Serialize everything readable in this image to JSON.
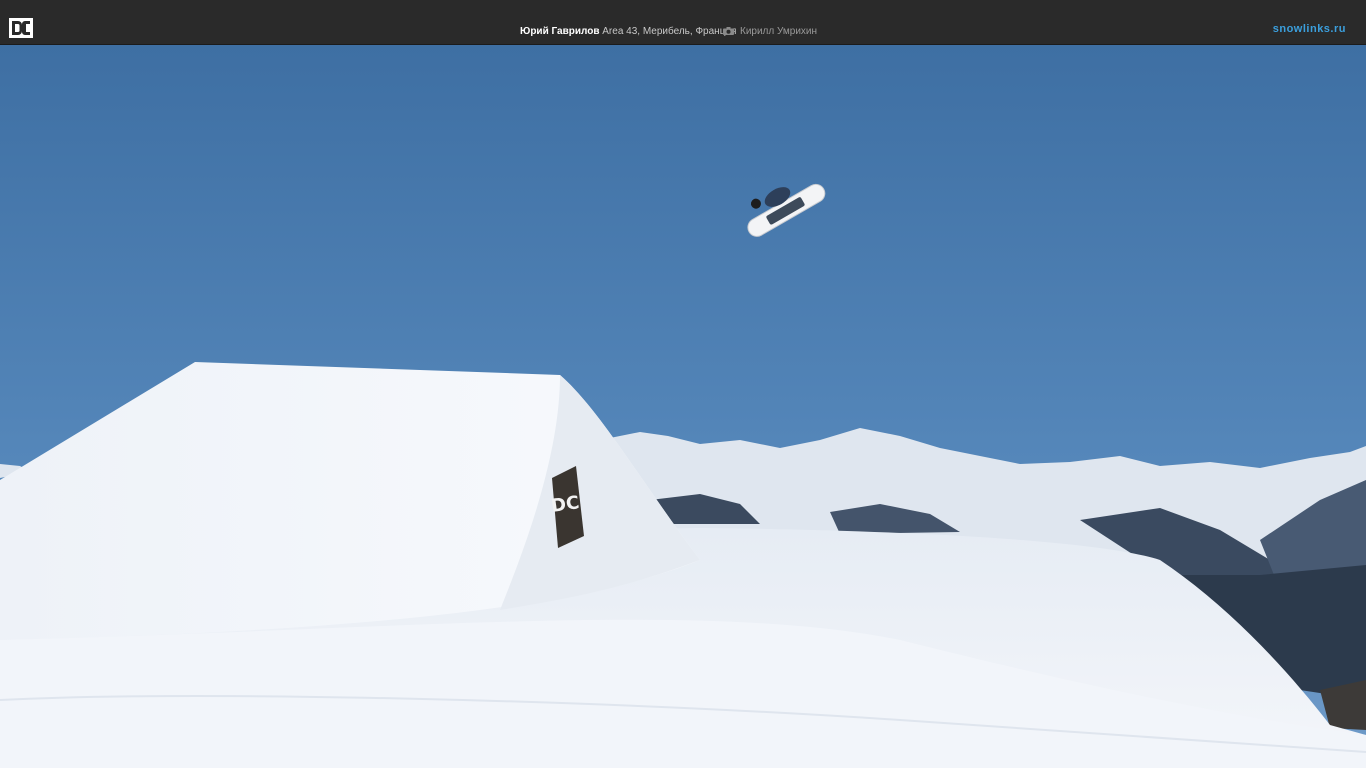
{
  "header": {
    "logo_text": "DC",
    "caption": {
      "athlete": "Юрий Гаврилов",
      "location": "Area 43, Мерибель, Франция"
    },
    "photographer": "Кирилл Умрихин",
    "site": "snowlinks.ru"
  },
  "photo": {
    "jump_logo_text": "DC"
  }
}
